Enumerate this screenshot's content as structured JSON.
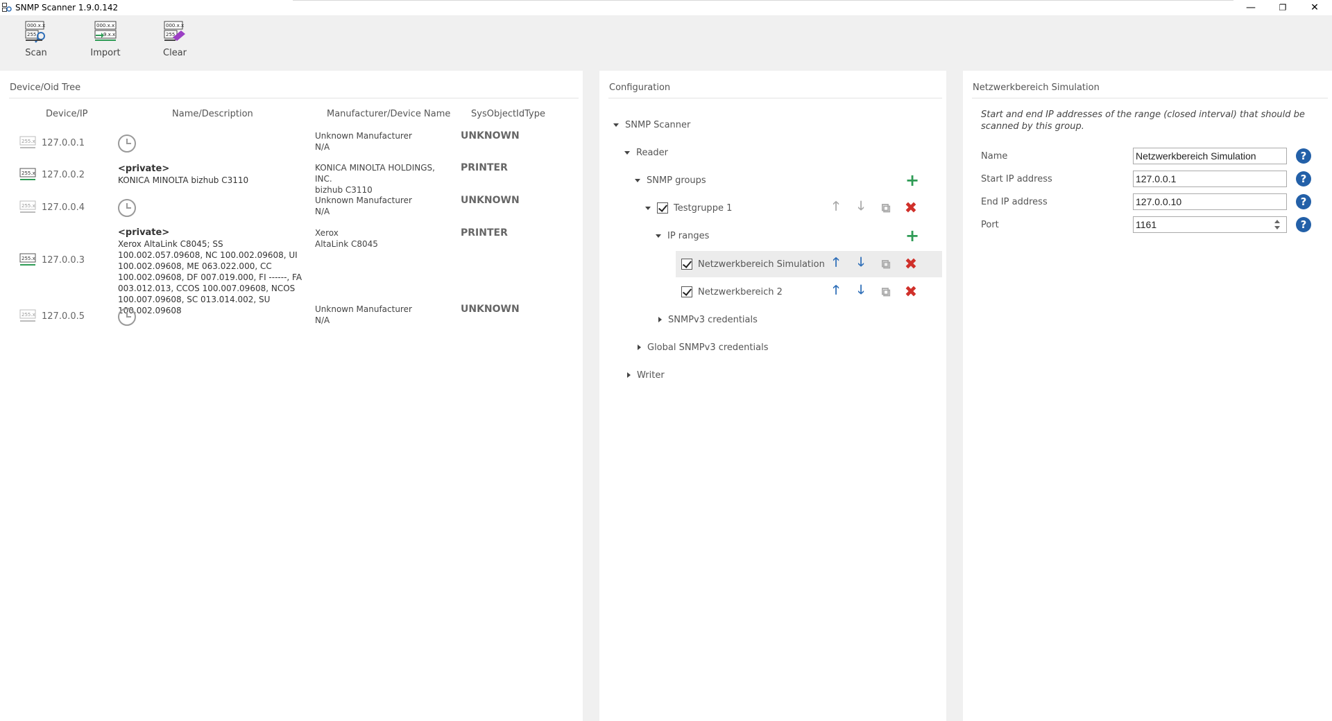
{
  "window": {
    "title": "SNMP Scanner 1.9.0.142",
    "minimize": "—",
    "restore": "❐",
    "close": "✕"
  },
  "toolbar": {
    "scan": "Scan",
    "import": "Import",
    "clear": "Clear"
  },
  "device_tree": {
    "title": "Device/Oid Tree",
    "columns": [
      "Device/IP",
      "Name/Description",
      "Manufacturer/Device Name",
      "SysObjectIdType"
    ],
    "rows": [
      {
        "ip": "127.0.0.1",
        "name": "",
        "description": "",
        "manufacturer": "Unknown Manufacturer",
        "device": "N/A",
        "type": "UNKNOWN"
      },
      {
        "ip": "127.0.0.2",
        "name": "<private>",
        "description": "KONICA MINOLTA bizhub C3110",
        "manufacturer": "KONICA MINOLTA HOLDINGS, INC.",
        "device": "bizhub C3110",
        "type": "PRINTER"
      },
      {
        "ip": "127.0.0.4",
        "name": "",
        "description": "",
        "manufacturer": "Unknown Manufacturer",
        "device": "N/A",
        "type": "UNKNOWN"
      },
      {
        "ip": "127.0.0.3",
        "name": "<private>",
        "description": "Xerox AltaLink C8045; SS 100.002.057.09608, NC 100.002.09608, UI 100.002.09608, ME 063.022.000, CC 100.002.09608, DF 007.019.000, FI ------, FA 003.012.013, CCOS 100.007.09608, NCOS 100.007.09608, SC 013.014.002, SU 100.002.09608",
        "manufacturer": "Xerox",
        "device": "AltaLink C8045",
        "type": "PRINTER"
      },
      {
        "ip": "127.0.0.5",
        "name": "",
        "description": "",
        "manufacturer": "Unknown Manufacturer",
        "device": "N/A",
        "type": "UNKNOWN"
      }
    ]
  },
  "configuration": {
    "title": "Configuration",
    "tree": {
      "root": "SNMP Scanner",
      "reader": "Reader",
      "snmp_groups": "SNMP groups",
      "group1": "Testgruppe 1",
      "ip_ranges": "IP ranges",
      "range1": "Netzwerkbereich Simulation",
      "range2": "Netzwerkbereich 2",
      "snmpv3": "SNMPv3 credentials",
      "global_snmpv3": "Global SNMPv3 credentials",
      "writer": "Writer"
    },
    "icons": {
      "add": "+",
      "up": "🡑",
      "down": "🡓",
      "copy": "⧉",
      "delete": "✖"
    }
  },
  "details": {
    "title": "Netzwerkbereich Simulation",
    "description": "Start and end IP addresses of the range (closed interval) that should be scanned by this group.",
    "fields": {
      "name_label": "Name",
      "name_value": "Netzwerkbereich Simulation",
      "start_label": "Start IP address",
      "start_value": "127.0.0.1",
      "end_label": "End IP address",
      "end_value": "127.0.0.10",
      "port_label": "Port",
      "port_value": "1161"
    },
    "help": "?"
  },
  "colors": {
    "add": "#2e9b55",
    "arrow": "#2f6fb8",
    "delete": "#d0302a",
    "help": "#2360a8",
    "selected_row": "#ececec"
  }
}
